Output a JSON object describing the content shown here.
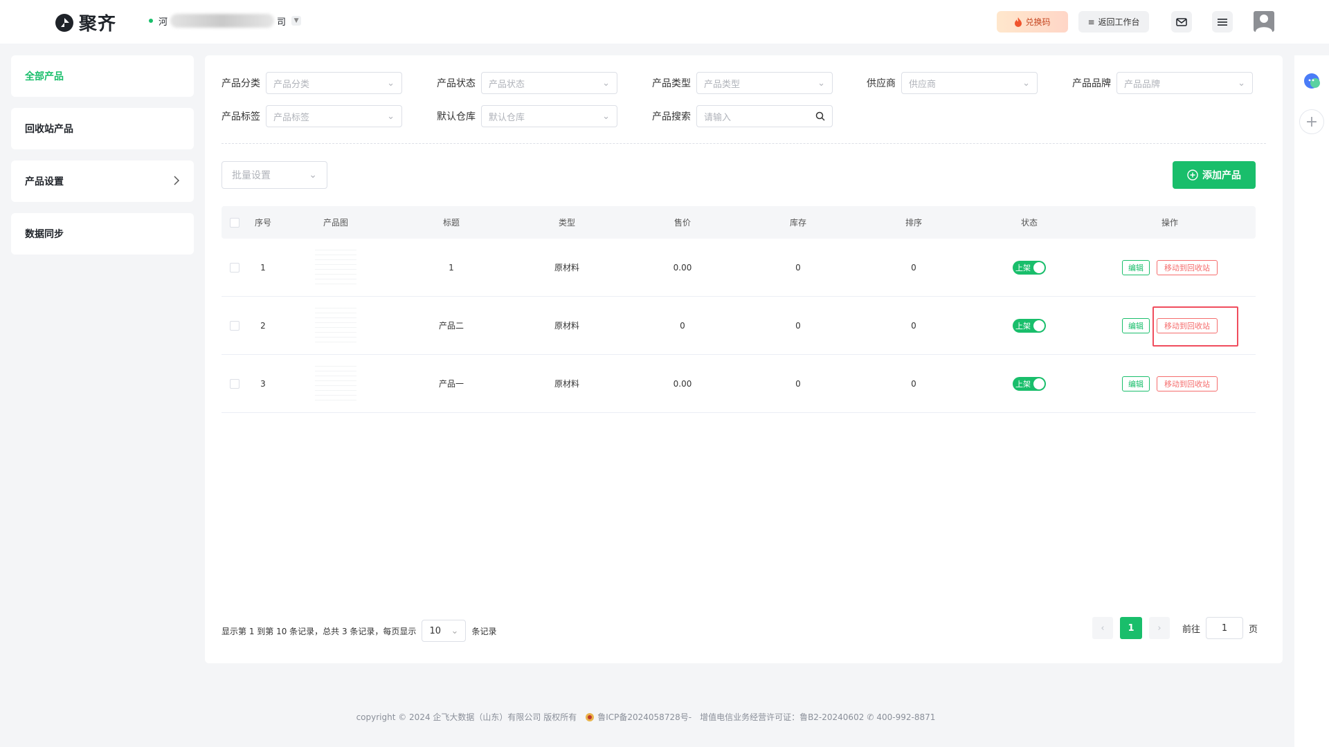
{
  "header": {
    "app_name": "聚齐",
    "company_prefix": "河",
    "company_suffix": "司",
    "redeem_label": "兑换码",
    "back_label": "返回工作台"
  },
  "sidebar": {
    "items": [
      {
        "label": "全部产品",
        "active": true
      },
      {
        "label": "回收站产品"
      },
      {
        "label": "产品设置"
      },
      {
        "label": "数据同步"
      }
    ]
  },
  "filters": {
    "category": {
      "label": "产品分类",
      "placeholder": "产品分类"
    },
    "status": {
      "label": "产品状态",
      "placeholder": "产品状态"
    },
    "type": {
      "label": "产品类型",
      "placeholder": "产品类型"
    },
    "supplier": {
      "label": "供应商",
      "placeholder": "供应商"
    },
    "brand": {
      "label": "产品品牌",
      "placeholder": "产品品牌"
    },
    "tag": {
      "label": "产品标签",
      "placeholder": "产品标签"
    },
    "warehouse": {
      "label": "默认仓库",
      "placeholder": "默认仓库"
    },
    "search": {
      "label": "产品搜索",
      "placeholder": "请输入"
    }
  },
  "toolbar": {
    "batch_placeholder": "批量设置",
    "add_label": "添加产品"
  },
  "table": {
    "columns": [
      "序号",
      "产品图",
      "标题",
      "类型",
      "售价",
      "库存",
      "排序",
      "状态",
      "操作"
    ],
    "rows": [
      {
        "no": "1",
        "title": "1",
        "type": "原材料",
        "price": "0.00",
        "stock": "0",
        "sort": "0",
        "status": "上架",
        "edit": "编辑",
        "move": "移动到回收站"
      },
      {
        "no": "2",
        "title": "产品二",
        "type": "原材料",
        "price": "0",
        "stock": "0",
        "sort": "0",
        "status": "上架",
        "edit": "编辑",
        "move": "移动到回收站"
      },
      {
        "no": "3",
        "title": "产品一",
        "type": "原材料",
        "price": "0.00",
        "stock": "0",
        "sort": "0",
        "status": "上架",
        "edit": "编辑",
        "move": "移动到回收站"
      }
    ]
  },
  "pagination": {
    "info": "显示第 1 到第 10 条记录，总共 3 条记录，每页显示",
    "page_size": "10",
    "unit": "条记录",
    "current": "1",
    "goto_label": "前往",
    "goto_value": "1",
    "page_suffix": "页"
  },
  "footer": {
    "copyright": "copyright © 2024 企飞大数据（山东）有限公司 版权所有",
    "icp": "鲁ICP备2024058728号-",
    "license": "增值电信业务经营许可证：鲁B2-20240602",
    "phone": "400-992-8871"
  },
  "colors": {
    "accent": "#19be6b",
    "danger": "#f56c6c",
    "highlight": "#f04c5c"
  }
}
